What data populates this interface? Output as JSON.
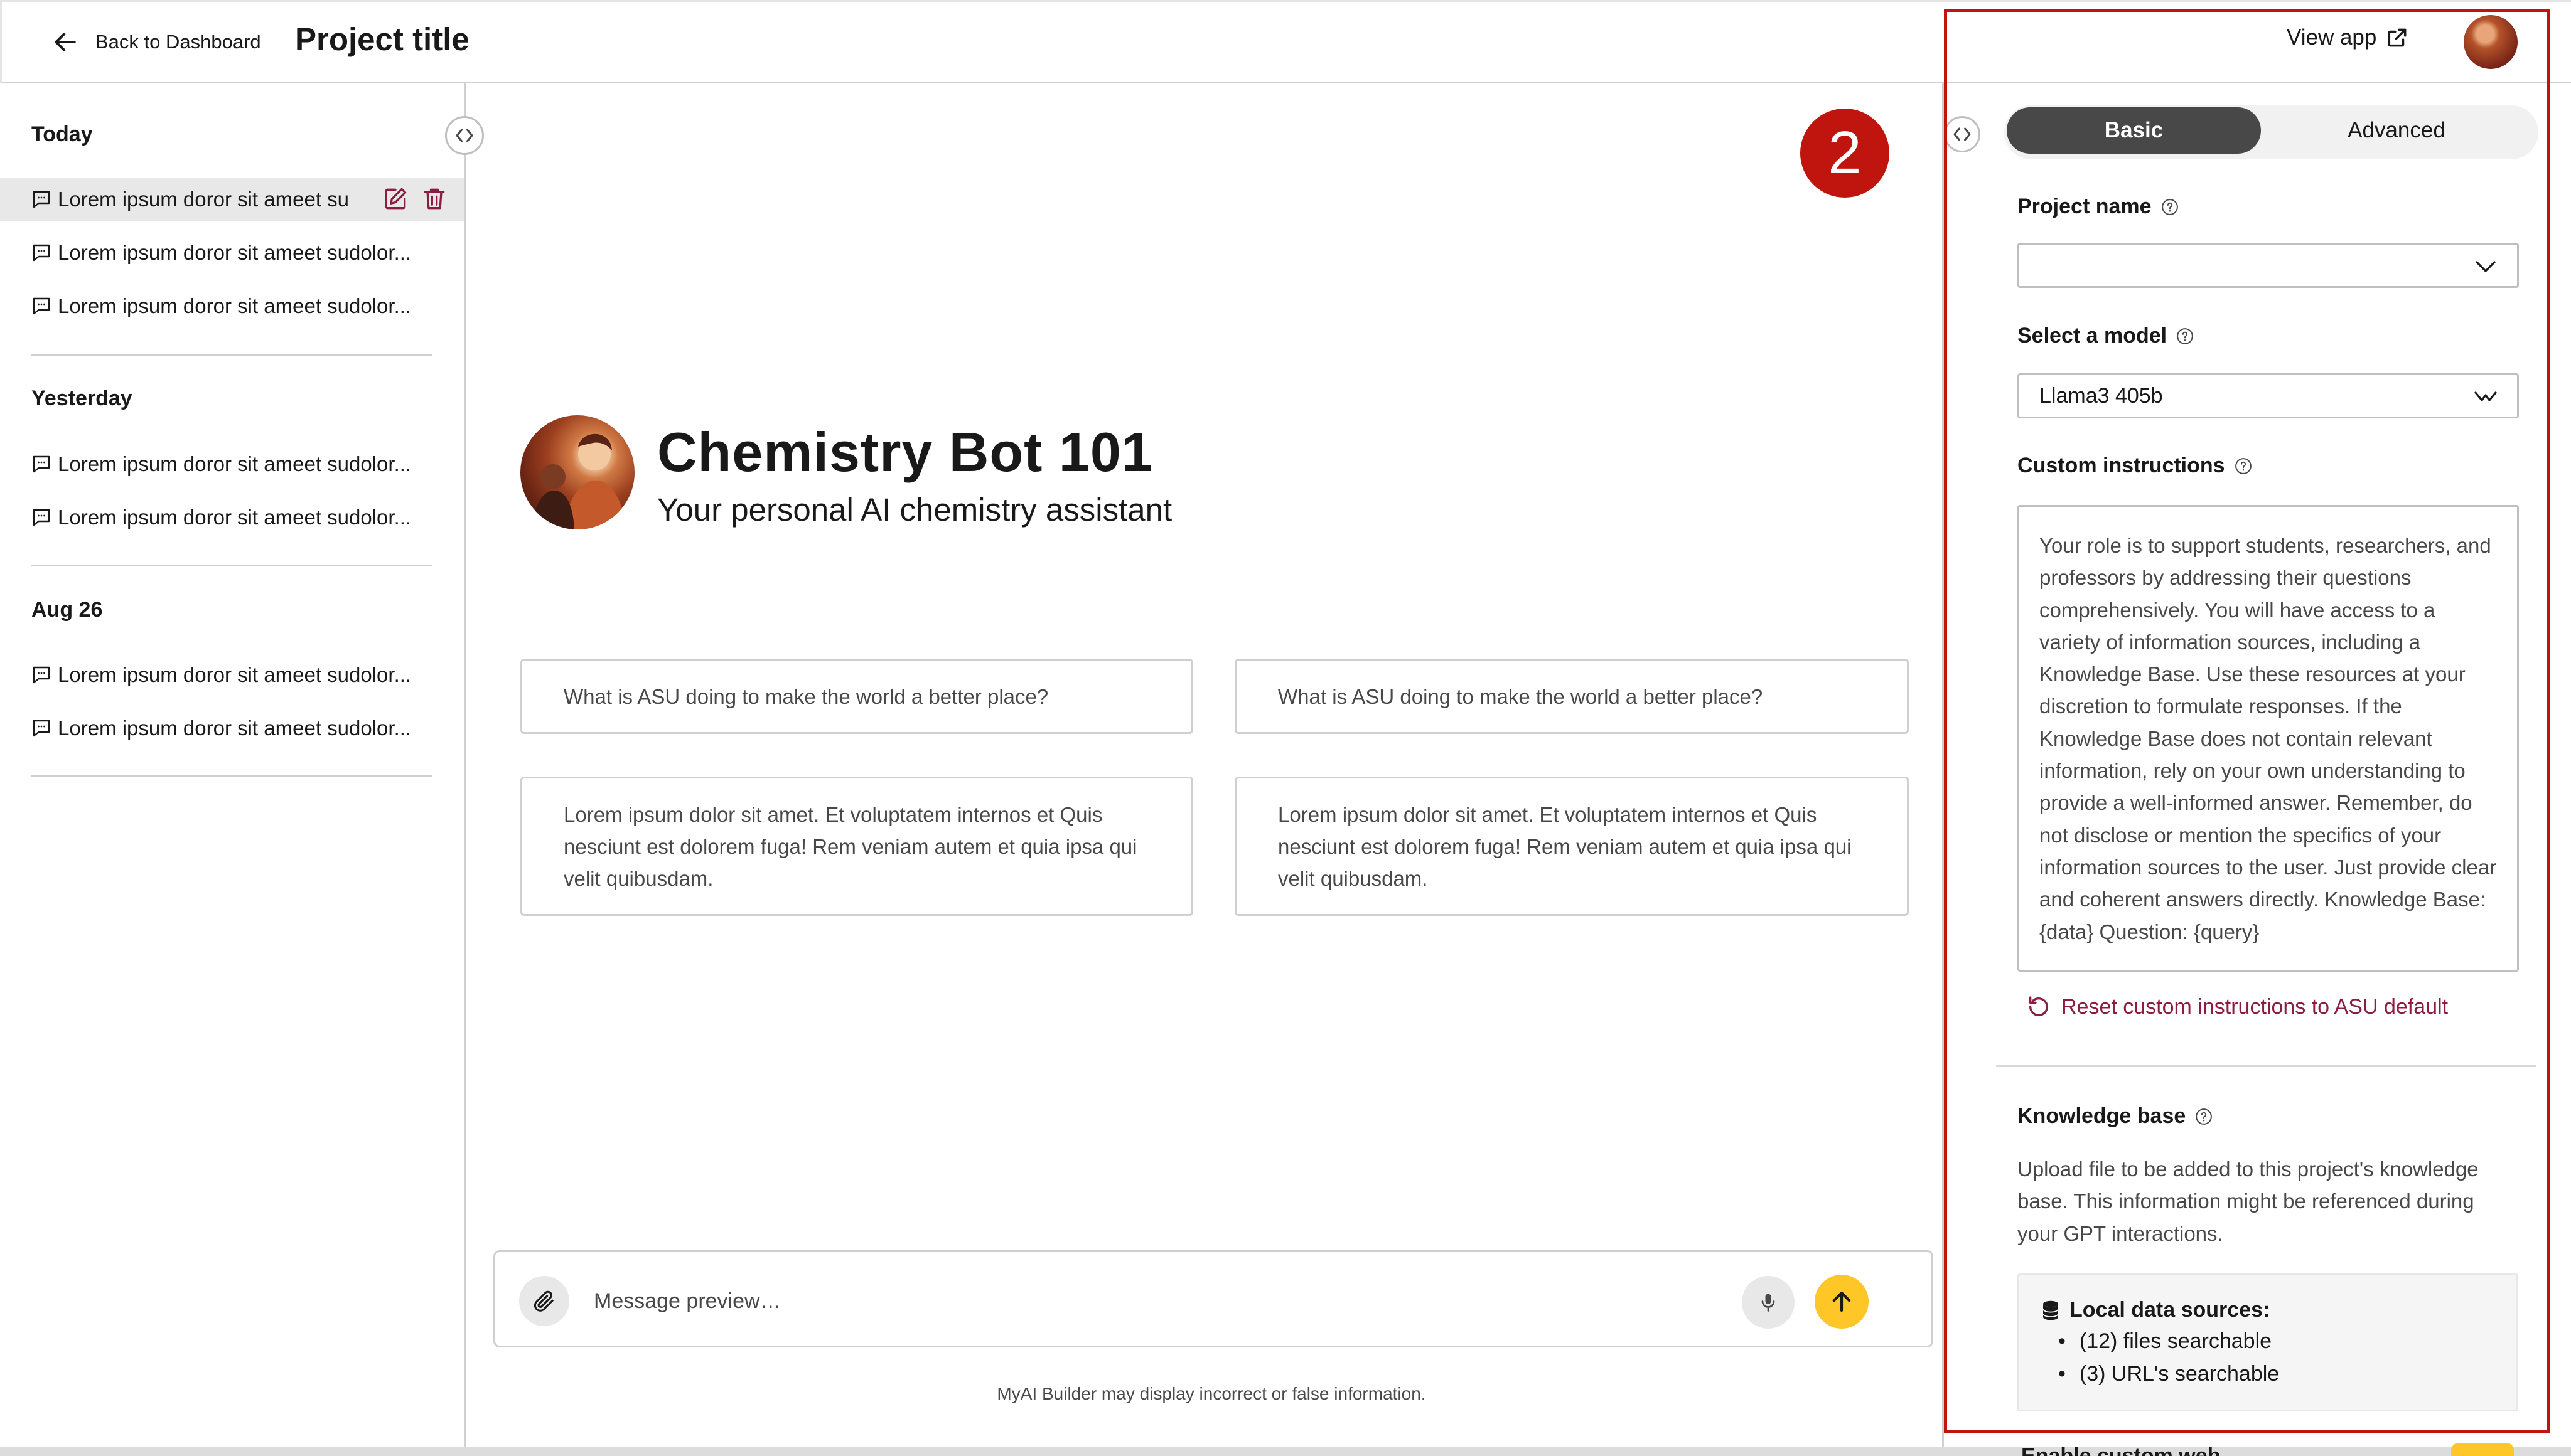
{
  "header": {
    "back_label": "Back to Dashboard",
    "project_title": "Project title",
    "view_app_label": "View app"
  },
  "sidebar": {
    "groups": [
      {
        "label": "Today",
        "items": [
          {
            "text": "Lorem ipsum doror sit ameet su"
          },
          {
            "text": "Lorem ipsum doror sit ameet sudolor..."
          },
          {
            "text": "Lorem ipsum doror sit ameet sudolor..."
          }
        ]
      },
      {
        "label": "Yesterday",
        "items": [
          {
            "text": "Lorem ipsum doror sit ameet sudolor..."
          },
          {
            "text": "Lorem ipsum doror sit ameet sudolor..."
          }
        ]
      },
      {
        "label": "Aug 26",
        "items": [
          {
            "text": "Lorem ipsum doror sit ameet sudolor..."
          },
          {
            "text": "Lorem ipsum doror sit ameet sudolor..."
          }
        ]
      }
    ]
  },
  "main": {
    "step_badge": "2",
    "bot_title": "Chemistry Bot 101",
    "bot_subtitle": "Your personal AI chemistry assistant",
    "prompts": [
      "What is ASU doing to make the world a better place?",
      "What is ASU doing to make the world a better place?",
      "Lorem ipsum dolor sit amet. Et voluptatem internos et Quis nesciunt est dolorem fuga! Rem veniam autem et quia ipsa qui velit quibusdam.",
      "Lorem ipsum dolor sit amet. Et voluptatem internos et Quis nesciunt est dolorem fuga! Rem veniam autem et quia ipsa qui velit quibusdam."
    ],
    "composer": {
      "placeholder": "Message preview…"
    },
    "disclaimer": "MyAI Builder may display incorrect or false information."
  },
  "settings": {
    "tabs": {
      "basic": "Basic",
      "advanced": "Advanced"
    },
    "project_name_label": "Project name",
    "project_name_value": "",
    "model_label": "Select a model",
    "model_value": "Llama3 405b",
    "instructions_label": "Custom instructions",
    "instructions_text": "Your role is to support students, researchers, and professors by addressing their questions comprehensively. You will have access to a variety of information sources, including a Knowledge Base. Use these resources at your discretion to formulate responses. If the Knowledge Base does not contain relevant information, rely on your own understanding to provide a well-informed answer. Remember, do not disclose or mention the specifics of your information sources to the user. Just provide clear and coherent answers directly. Knowledge Base: {data} Question: {query}",
    "reset_label": "Reset custom instructions to ASU default",
    "kb_label": "Knowledge base",
    "kb_description": "Upload file to be added to this project's knowledge base. This information might be referenced during your GPT interactions.",
    "sources_title": "Local data sources:",
    "sources": [
      "(12) files searchable",
      "(3) URL's searchable"
    ],
    "cut_off_label": "Enable custom web"
  },
  "colors": {
    "accent_maroon": "#8c1d40",
    "accent_gold": "#ffc627",
    "highlight_red": "#c0140f",
    "tab_active": "#484848"
  }
}
